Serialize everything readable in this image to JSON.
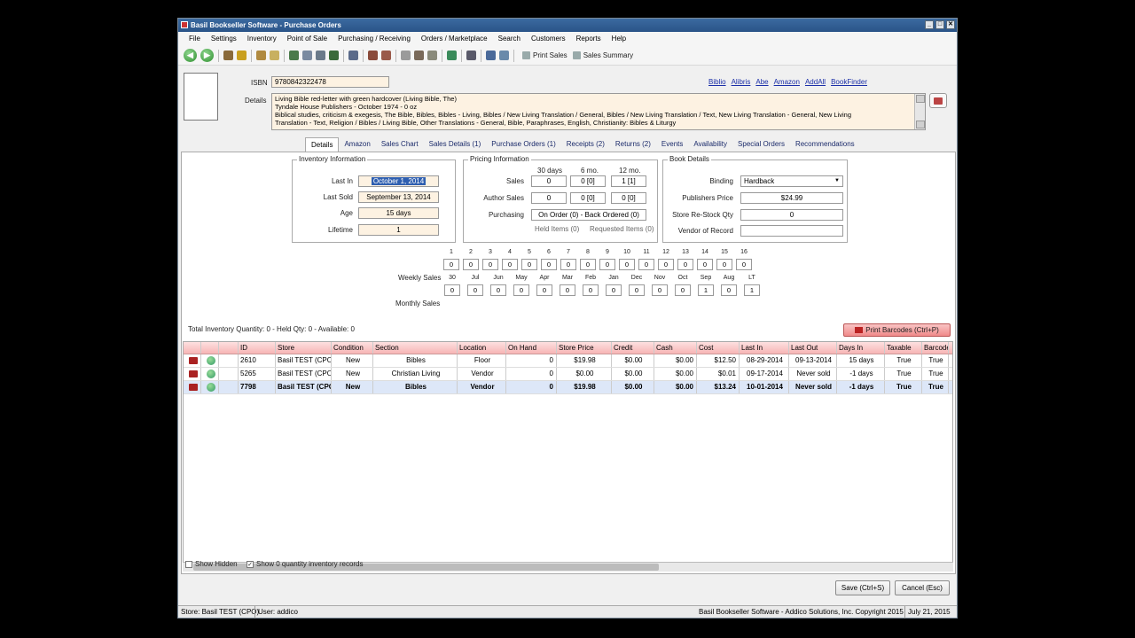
{
  "window": {
    "title": "Basil Bookseller Software - Purchase Orders",
    "buttons": [
      "_",
      "□",
      "✕"
    ]
  },
  "menu": [
    "File",
    "Settings",
    "Inventory",
    "Point of Sale",
    "Purchasing / Receiving",
    "Orders / Marketplace",
    "Search",
    "Customers",
    "Reports",
    "Help"
  ],
  "toolbar": {
    "print_sales": "Print Sales",
    "sales_summary": "Sales Summary"
  },
  "isbn": {
    "label": "ISBN",
    "value": "9780842322478"
  },
  "details": {
    "label": "Details",
    "lines": [
      "Living Bible red-letter with green hardcover (Living Bible, The)",
      "Tyndale House Publishers - October 1974 - 0 oz",
      "Biblical studies, criticism & exegesis, The Bible, Bibles, Bibles - Living, Bibles / New Living Translation / General, Bibles / New Living Translation / Text, New Living Translation - General, New Living",
      "Translation - Text, Religion / Bibles / Living Bible, Other Translations - General, Bible, Paraphrases, English, Christianity: Bibles & Liturgy"
    ]
  },
  "links": [
    "Biblio",
    "Alibris",
    "Abe",
    "Amazon",
    "AddAll",
    "BookFinder"
  ],
  "tabs": [
    "Details",
    "Amazon",
    "Sales Chart",
    "Sales Details (1)",
    "Purchase Orders (1)",
    "Receipts (2)",
    "Returns (2)",
    "Events",
    "Availability",
    "Special Orders",
    "Recommendations"
  ],
  "inventory": {
    "title": "Inventory Information",
    "last_in_label": "Last In",
    "last_in": "October 1, 2014",
    "last_sold_label": "Last Sold",
    "last_sold": "September 13, 2014",
    "age_label": "Age",
    "age": "15 days",
    "lifetime_label": "Lifetime",
    "lifetime": "1"
  },
  "pricing": {
    "title": "Pricing Information",
    "col30": "30 days",
    "col6": "6 mo.",
    "col12": "12 mo.",
    "sales_label": "Sales",
    "sales": [
      "0",
      "0 [0]",
      "1 [1]"
    ],
    "author_label": "Author Sales",
    "author": [
      "0",
      "0 [0]",
      "0 [0]"
    ],
    "purch_label": "Purchasing",
    "purch": "On Order (0) - Back Ordered (0)",
    "held": "Held Items (0)",
    "requested": "Requested Items (0)"
  },
  "book": {
    "title": "Book Details",
    "binding_label": "Binding",
    "binding": "Hardback",
    "pub_price_label": "Publishers Price",
    "pub_price": "$24.99",
    "restock_label": "Store Re-Stock Qty",
    "restock": "0",
    "vendor_label": "Vendor of Record",
    "vendor": ""
  },
  "weekly": {
    "label": "Weekly Sales",
    "heads": [
      "1",
      "2",
      "3",
      "4",
      "5",
      "6",
      "7",
      "8",
      "9",
      "10",
      "11",
      "12",
      "13",
      "14",
      "15",
      "16"
    ],
    "values": [
      "0",
      "0",
      "0",
      "0",
      "0",
      "0",
      "0",
      "0",
      "0",
      "0",
      "0",
      "0",
      "0",
      "0",
      "0",
      "0"
    ]
  },
  "monthly": {
    "label": "Monthly Sales",
    "heads": [
      "30",
      "Jul",
      "Jun",
      "May",
      "Apr",
      "Mar",
      "Feb",
      "Jan",
      "Dec",
      "Nov",
      "Oct",
      "Sep",
      "Aug",
      "LT"
    ],
    "values": [
      "0",
      "0",
      "0",
      "0",
      "0",
      "0",
      "0",
      "0",
      "0",
      "0",
      "0",
      "1",
      "0",
      "1"
    ]
  },
  "totals": "Total Inventory Quantity: 0 - Held Qty: 0 - Available: 0",
  "print_barcodes": "Print Barcodes  (Ctrl+P)",
  "table": {
    "headers": [
      "",
      "",
      "",
      "ID",
      "Store",
      "Condition",
      "Section",
      "Location",
      "On Hand",
      "Store Price",
      "Credit",
      "Cash",
      "Cost",
      "Last In",
      "Last Out",
      "Days In",
      "Taxable",
      "Barcode"
    ],
    "rows": [
      [
        "2610",
        "Basil TEST (CPO)",
        "New",
        "Bibles",
        "Floor",
        "0",
        "$19.98",
        "$0.00",
        "$0.00",
        "$12.50",
        "08-29-2014",
        "09-13-2014",
        "15 days",
        "True",
        "True"
      ],
      [
        "5265",
        "Basil TEST (CPO)",
        "New",
        "Christian Living",
        "Vendor",
        "0",
        "$0.00",
        "$0.00",
        "$0.00",
        "$0.01",
        "09-17-2014",
        "Never sold",
        "-1 days",
        "True",
        "True"
      ],
      [
        "7798",
        "Basil TEST (CPO)",
        "New",
        "Bibles",
        "Vendor",
        "0",
        "$19.98",
        "$0.00",
        "$0.00",
        "$13.24",
        "10-01-2014",
        "Never sold",
        "-1 days",
        "True",
        "True"
      ]
    ]
  },
  "show_hidden": "Show Hidden",
  "show_zero": "Show 0 quantity inventory records",
  "save": "Save  (Ctrl+S)",
  "cancel": "Cancel  (Esc)",
  "status": {
    "store": "Store: Basil TEST (CPO)",
    "user": "User: addico",
    "copyright": "Basil Bookseller Software - Addico Solutions, Inc. Copyright 2015",
    "date": "July 21, 2015"
  }
}
